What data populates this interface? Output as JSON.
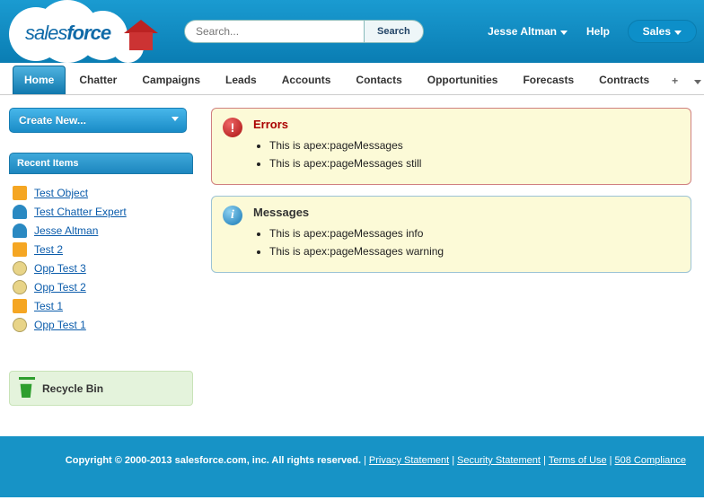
{
  "header": {
    "logo_text_plain": "sales",
    "logo_text_bold": "force",
    "search_placeholder": "Search...",
    "search_button": "Search",
    "user_name": "Jesse Altman",
    "help_label": "Help",
    "app_selected": "Sales"
  },
  "tabs": {
    "items": [
      "Home",
      "Chatter",
      "Campaigns",
      "Leads",
      "Accounts",
      "Contacts",
      "Opportunities",
      "Forecasts",
      "Contracts"
    ],
    "active_index": 0,
    "plus": "+"
  },
  "sidebar": {
    "create_label": "Create New...",
    "recent_header": "Recent Items",
    "recent": [
      {
        "label": "Test Object",
        "icon": "ic-box"
      },
      {
        "label": "Test Chatter Expert",
        "icon": "ic-user"
      },
      {
        "label": "Jesse Altman",
        "icon": "ic-user"
      },
      {
        "label": "Test 2",
        "icon": "ic-box"
      },
      {
        "label": "Opp Test 3",
        "icon": "ic-opp"
      },
      {
        "label": "Opp Test 2",
        "icon": "ic-opp"
      },
      {
        "label": "Test 1",
        "icon": "ic-box"
      },
      {
        "label": "Opp Test 1",
        "icon": "ic-opp"
      }
    ],
    "recycle_label": "Recycle Bin"
  },
  "messages": {
    "errors": {
      "title": "Errors",
      "items": [
        "This is apex:pageMessages",
        "This is apex:pageMessages still"
      ]
    },
    "info": {
      "title": "Messages",
      "items": [
        "This is apex:pageMessages info",
        "This is apex:pageMessages warning"
      ]
    }
  },
  "footer": {
    "copyright": "Copyright © 2000-2013 salesforce.com, inc. All rights reserved.",
    "links": [
      "Privacy Statement",
      "Security Statement",
      "Terms of Use",
      "508 Compliance"
    ]
  }
}
